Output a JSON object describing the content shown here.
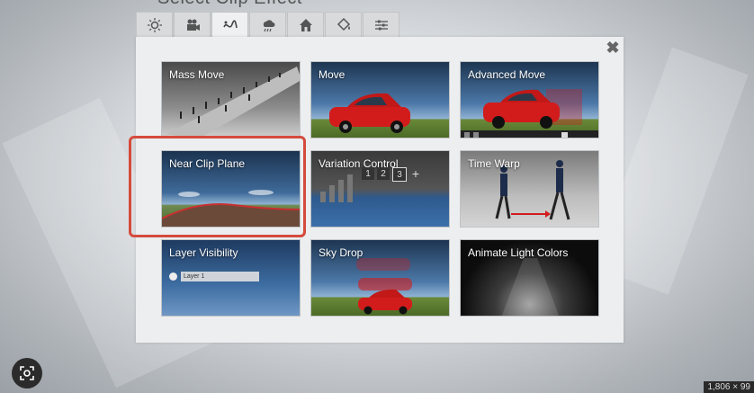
{
  "dialog": {
    "title": "Select Clip Effect",
    "close_glyph": "✖"
  },
  "tabs": [
    {
      "icon": "sun-icon"
    },
    {
      "icon": "camera-icon"
    },
    {
      "icon": "motion-icon"
    },
    {
      "icon": "weather-icon"
    },
    {
      "icon": "house-icon"
    },
    {
      "icon": "paint-bucket-icon"
    },
    {
      "icon": "sliders-icon"
    }
  ],
  "effects": [
    {
      "label": "Mass Move"
    },
    {
      "label": "Move"
    },
    {
      "label": "Advanced Move"
    },
    {
      "label": "Near Clip Plane"
    },
    {
      "label": "Variation Control"
    },
    {
      "label": "Time Warp"
    },
    {
      "label": "Layer Visibility"
    },
    {
      "label": "Sky Drop"
    },
    {
      "label": "Animate Light Colors"
    }
  ],
  "variation_control": {
    "numbers": [
      "1",
      "2",
      "3"
    ],
    "plus": "+"
  },
  "layer_visibility": {
    "layer_name": "Layer 1"
  },
  "footer": {
    "size_label": "1,806 × 99"
  },
  "colors": {
    "highlight": "#d44b3d",
    "car": "#d21c1c"
  }
}
